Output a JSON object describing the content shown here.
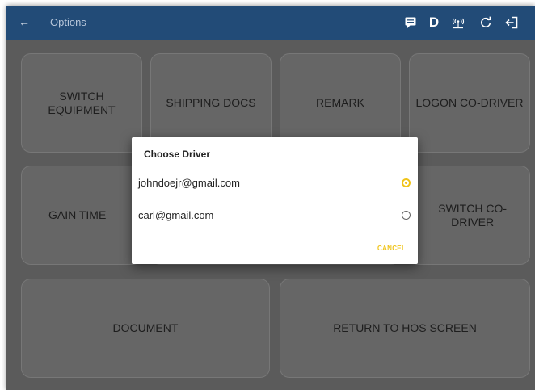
{
  "appbar": {
    "back_icon": "←",
    "title": "Options",
    "icons": [
      "message-icon",
      "driver-d-icon",
      "signal-icon",
      "refresh-icon",
      "logout-icon"
    ],
    "driver_letter": "D"
  },
  "tiles": [
    {
      "id": "switch-equipment",
      "label": "SWITCH\nEQUIPMENT"
    },
    {
      "id": "shipping-docs",
      "label": "SHIPPING DOCS"
    },
    {
      "id": "remark",
      "label": "REMARK"
    },
    {
      "id": "logon-co-driver",
      "label": "LOGON CO-DRIVER"
    },
    {
      "id": "gain-time",
      "label": "GAIN TIME"
    },
    {
      "id": "switch-co-driver",
      "label": "SWITCH CO-\nDRIVER"
    },
    {
      "id": "document",
      "label": "DOCUMENT"
    },
    {
      "id": "return-to-hos",
      "label": "RETURN TO HOS SCREEN"
    }
  ],
  "dialog": {
    "title": "Choose Driver",
    "options": [
      {
        "email": "johndoejr@gmail.com",
        "selected": true
      },
      {
        "email": "carl@gmail.com",
        "selected": false
      }
    ],
    "cancel_label": "CANCEL"
  },
  "colors": {
    "appbar": "#224b77",
    "accent": "#f0c419",
    "backdrop": "#5b5b5b",
    "tile": "#666666"
  }
}
